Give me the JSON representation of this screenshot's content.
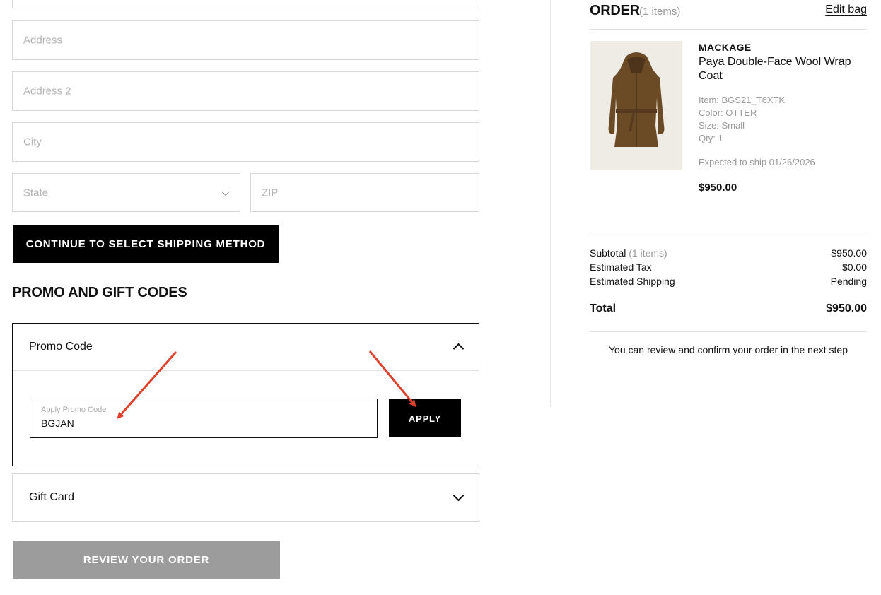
{
  "form": {
    "address_placeholder": "Address",
    "address2_placeholder": "Address 2",
    "city_placeholder": "City",
    "state_placeholder": "State",
    "zip_placeholder": "ZIP",
    "continue_label": "CONTINUE TO SELECT SHIPPING METHOD"
  },
  "promo_section": {
    "title": "PROMO AND GIFT CODES",
    "promo_code": {
      "label": "Promo Code",
      "input_label": "Apply Promo Code",
      "input_value": "BGJAN",
      "apply_label": "APPLY",
      "expanded": true
    },
    "gift_card": {
      "label": "Gift Card",
      "expanded": false
    }
  },
  "review_label": "REVIEW YOUR ORDER",
  "order": {
    "title": "ORDER",
    "count": "(1 items)",
    "edit_bag": "Edit bag",
    "item": {
      "brand": "MACKAGE",
      "name": "Paya Double-Face Wool Wrap Coat",
      "item_no": "Item: BGS21_T6XTK",
      "color": "Color: OTTER",
      "size": "Size: Small",
      "qty": "Qty: 1",
      "ship": "Expected to ship 01/26/2026",
      "price": "$950.00",
      "image_icon": "wool-wrap-coat-image"
    },
    "summary": {
      "subtotal_label": "Subtotal",
      "subtotal_count": "(1 items)",
      "subtotal_value": "$950.00",
      "tax_label": "Estimated Tax",
      "tax_value": "$0.00",
      "shipping_label": "Estimated Shipping",
      "shipping_value": "Pending",
      "total_label": "Total",
      "total_value": "$950.00"
    },
    "note": "You can review and confirm your order in the next step"
  },
  "colors": {
    "primary": "#000000",
    "disabled_button": "#9c9c9c",
    "annotation_arrow": "#e0402a",
    "coat": "#6b4a26"
  }
}
